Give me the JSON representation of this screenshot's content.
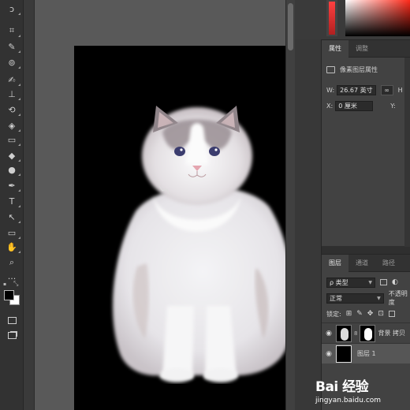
{
  "tools": [
    {
      "name": "lasso-tool-icon",
      "glyph": "ↄ"
    },
    {
      "name": "crop-tool-icon",
      "glyph": "⌗"
    },
    {
      "name": "eyedropper-tool-icon",
      "glyph": "✎"
    },
    {
      "name": "healing-brush-tool-icon",
      "glyph": "⊚"
    },
    {
      "name": "brush-tool-icon",
      "glyph": "✍"
    },
    {
      "name": "clone-stamp-tool-icon",
      "glyph": "⊥"
    },
    {
      "name": "history-brush-tool-icon",
      "glyph": "⟲"
    },
    {
      "name": "eraser-tool-icon",
      "glyph": "◈"
    },
    {
      "name": "gradient-tool-icon",
      "glyph": "▭"
    },
    {
      "name": "blur-tool-icon",
      "glyph": "◆"
    },
    {
      "name": "dodge-tool-icon",
      "glyph": "●"
    },
    {
      "name": "pen-tool-icon",
      "glyph": "✒"
    },
    {
      "name": "type-tool-icon",
      "glyph": "T"
    },
    {
      "name": "path-selection-tool-icon",
      "glyph": "↖"
    },
    {
      "name": "rectangle-tool-icon",
      "glyph": "▭"
    },
    {
      "name": "hand-tool-icon",
      "glyph": "✋"
    },
    {
      "name": "zoom-tool-icon",
      "glyph": "⌕"
    },
    {
      "name": "more-tools-icon",
      "glyph": "···"
    }
  ],
  "properties_panel": {
    "tabs": [
      "属性",
      "调整"
    ],
    "section_title": "像素图层属性",
    "width_label": "W:",
    "width_value": "26.67 英寸",
    "x_label": "X:",
    "x_value": "0 厘米",
    "y_label": "Y:"
  },
  "layers_panel": {
    "tabs": [
      "图层",
      "通道",
      "路径"
    ],
    "filter_select": "ρ 类型",
    "blend_mode": "正常",
    "opacity_label": "不透明度",
    "lock_label": "锁定:",
    "layers": [
      {
        "name": "背景 拷贝",
        "visible": true,
        "selected": false
      },
      {
        "name": "图层 1",
        "visible": true,
        "selected": true
      }
    ]
  },
  "colors": {
    "foreground": "#000000",
    "background": "#ffffff",
    "accent_red": "#ff2a1a"
  },
  "watermark": {
    "logo": "Bai 经验",
    "url": "jingyan.baidu.com"
  }
}
